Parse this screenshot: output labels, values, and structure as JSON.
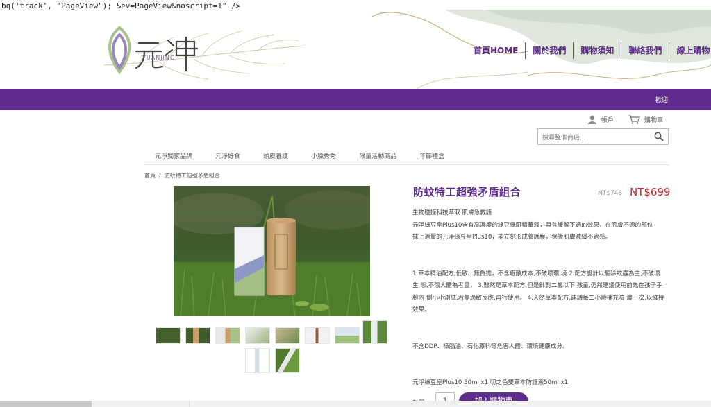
{
  "leak_text": "bq('track', \"PageView\"); &ev=PageView&noscript=1\" />",
  "logo": {
    "wordmark": "YUANJING"
  },
  "topnav": [
    "首頁HOME",
    "關於我們",
    "購物須知",
    "聯絡我們",
    "線上購物"
  ],
  "welcome": "歡迎",
  "account": {
    "account_label": "帳戶",
    "cart_label": "購物車"
  },
  "search": {
    "placeholder": "搜尋整個商店..."
  },
  "categories": [
    "元淨獨家品牌",
    "元淨好食",
    "頭皮養護",
    "小臉秀秀",
    "限量活動商品",
    "年節禮盒"
  ],
  "breadcrumb": {
    "home": "首頁",
    "sep": "/",
    "current": "防蚊特工超強矛盾組合"
  },
  "product": {
    "title": "防蚊特工超強矛盾組合",
    "old_price": "NT$748",
    "price": "NT$699",
    "desc": [
      "生物碰撞科技萃取 肌膚急救護",
      "元淨綠豆皇Plus10含有高濃度的綠豆綠酊精華液，具有緩解不適的效果，在肌膚不適的部位",
      "抹上適量的元淨綠豆皇Plus10，能立刻形成養護膜，保護肌膚減緩不適感。",
      "",
      "1.草本精油配方,低敏、無負擔，不含避敵成本,不破壞環 境 2.配方設計以驅除蚊蟲為主,不破壞",
      "生 態,不傷人體為考量， 3.雖然是草本配方,但是針對二歲以下 孩童,仍然建議使用前先在孩子手",
      "腕內 側小小測試,若無過敏反應,再行使用。 4.天然草本配方,建議每二小時補充噴 灑一次,以維持",
      "效果。",
      "",
      "不含DDP、樟腦油、石化原料等危害人體、環境健康成分。",
      "",
      "元淨綠豆皇Plus10 30ml x1 叨之色雙草本防護液50ml x1"
    ],
    "qty_label": "數量：",
    "qty_value": "1",
    "add_to_cart": "加入購物車"
  },
  "colors": {
    "brand_purple": "#5f2b8c",
    "price_red": "#c6282b"
  }
}
